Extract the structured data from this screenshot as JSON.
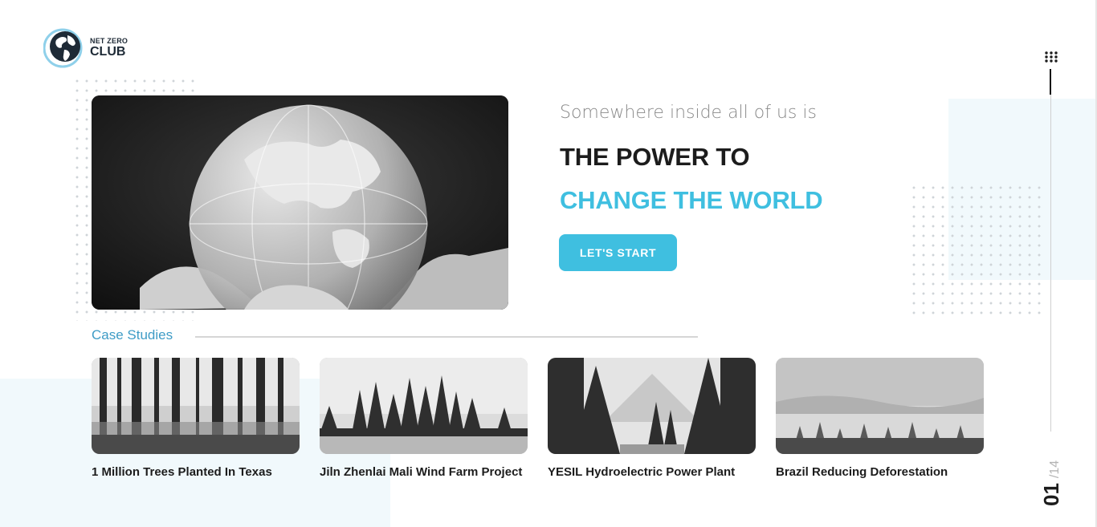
{
  "brand": {
    "line1": "NET ZERO",
    "line2": "CLUB"
  },
  "hero": {
    "subtitle": "Somewhere inside all of us is",
    "title_line1": "THE POWER TO",
    "title_line2": "CHANGE THE WORLD",
    "cta_label": "LET'S START"
  },
  "case_studies": {
    "heading": "Case Studies",
    "items": [
      {
        "title": "1 Million Trees Planted In Texas"
      },
      {
        "title": "Jiln Zhenlai Mali Wind Farm Project"
      },
      {
        "title": "YESIL Hydroelectric Power Plant"
      },
      {
        "title": "Brazil Reducing Deforestation"
      }
    ]
  },
  "pager": {
    "current": "01",
    "separator": "/",
    "total": "14"
  },
  "colors": {
    "accent": "#3fbfe0",
    "heading_blue": "#3f9cc6",
    "panel_bg": "#f1f9fc",
    "text_dark": "#1c1c1c"
  }
}
